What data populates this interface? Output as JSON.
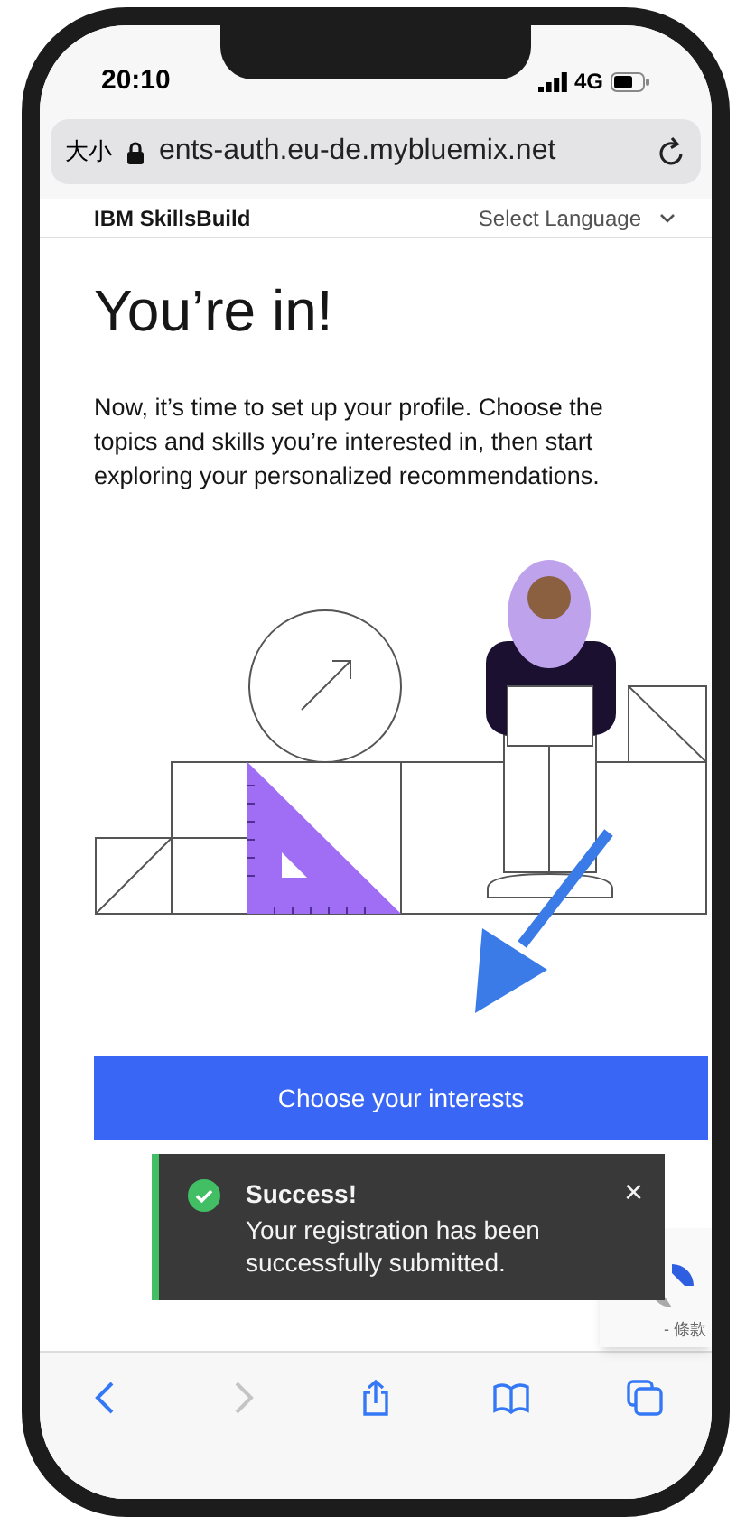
{
  "status_bar": {
    "time": "20:10",
    "network": "4G"
  },
  "address_bar": {
    "text_size_button": "大小",
    "url": "ents-auth.eu-de.mybluemix.net"
  },
  "site_header": {
    "logo": "IBM SkillsBuild",
    "language_select": "Select Language"
  },
  "heading": "You’re in!",
  "intro": "Now, it’s time to set up your profile. Choose the topics and skills you’re interested in, then start exploring your personalized recommendations.",
  "primary_button": "Choose your interests",
  "toast": {
    "kind": "success",
    "title": "Success!",
    "message": "Your registration has been successfully submitted.",
    "close": "×"
  },
  "recaptcha": {
    "links": "- 條款"
  },
  "toolbar": [
    {
      "kind": "back",
      "disabled": false
    },
    {
      "kind": "forward",
      "disabled": true
    },
    {
      "kind": "share",
      "disabled": false
    },
    {
      "kind": "bookmarks",
      "disabled": false
    },
    {
      "kind": "tabs",
      "disabled": false
    }
  ]
}
